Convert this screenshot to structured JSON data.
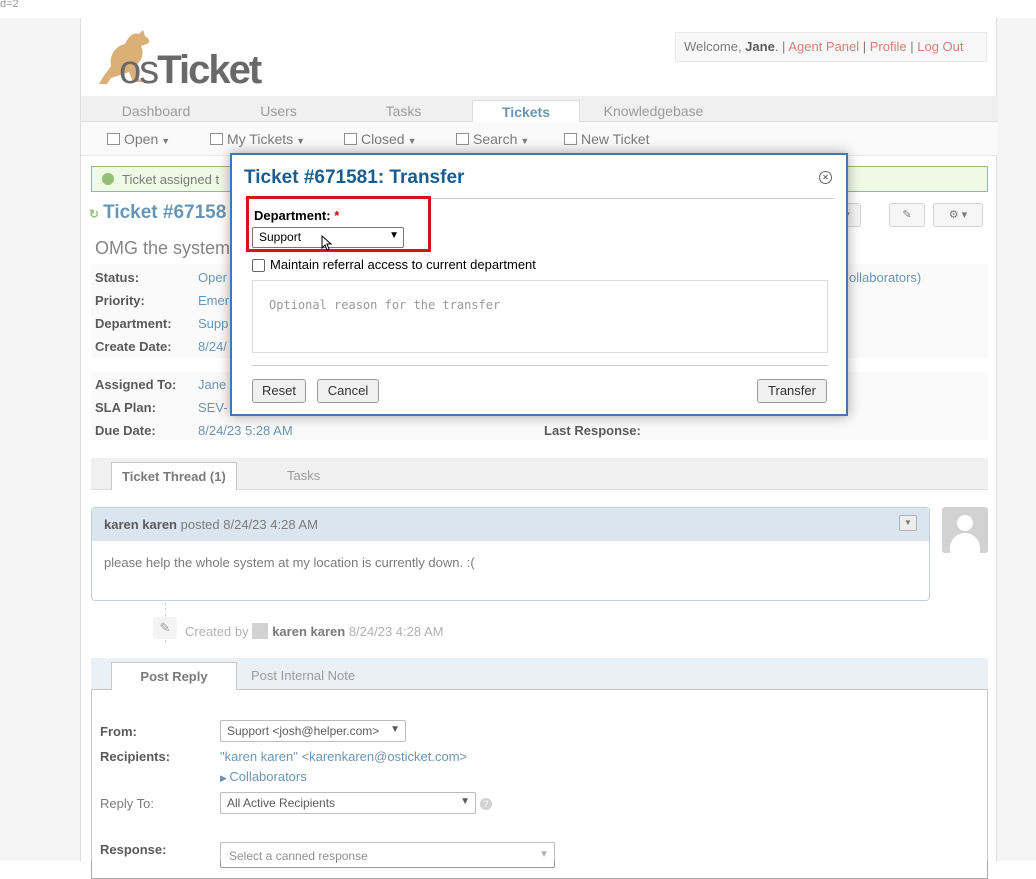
{
  "url_fragment": "d=2",
  "header": {
    "logo_text_os": "os",
    "logo_text_ticket": "Ticket",
    "welcome_prefix": "Welcome, ",
    "user": "Jane",
    "sep": ". | ",
    "agent_panel": "Agent Panel",
    "profile": "Profile",
    "logout": "Log Out"
  },
  "nav": {
    "tabs": [
      "Dashboard",
      "Users",
      "Tasks",
      "Tickets",
      "Knowledgebase"
    ],
    "active": "Tickets"
  },
  "subnav": {
    "open": "Open",
    "my_tickets": "My Tickets",
    "closed": "Closed",
    "search": "Search",
    "new_ticket": "New Ticket"
  },
  "notice": "Ticket assigned t",
  "ticket": {
    "number": "Ticket #67158",
    "subject": "OMG the system"
  },
  "info": {
    "status_k": "Status:",
    "status_v": "Oper",
    "priority_k": "Priority:",
    "priority_v": "Emer",
    "department_k": "Department:",
    "department_v": "Supp",
    "create_k": "Create Date:",
    "create_v": "8/24/",
    "collab_v": "ollaborators)",
    "assigned_k": "Assigned To:",
    "assigned_v": "Jane",
    "sla_k": "SLA Plan:",
    "sla_v": "SEV-",
    "due_k": "Due Date:",
    "due_v": "8/24/23 5:28 AM",
    "last_response_k": "Last Response:"
  },
  "thread_tabs": [
    "Ticket Thread (1)",
    "Tasks"
  ],
  "entry": {
    "poster": "karen karen",
    "posted": " posted 8/24/23 4:28 AM",
    "body": "please help the whole system at my location is currently down. :("
  },
  "event": {
    "created_by": "Created by ",
    "user": "karen karen",
    "time": " 8/24/23 4:28 AM"
  },
  "reply_tabs": [
    "Post Reply",
    "Post Internal Note"
  ],
  "reply": {
    "from_k": "From:",
    "from_v": "Support <josh@helper.com>",
    "recipients_k": "Recipients:",
    "recipients_v": "\"karen karen\" <karenkaren@osticket.com>",
    "collaborators": "Collaborators",
    "reply_to_k": "Reply To:",
    "reply_to_v": "All Active Recipients",
    "response_k": "Response:",
    "response_v": "Select a canned response"
  },
  "modal": {
    "title": "Ticket #671581: Transfer",
    "dept_label": "Department:",
    "required_mark": "*",
    "dept_value": "Support",
    "referral_label": "Maintain referral access to current department",
    "reason_placeholder": "Optional reason for the transfer",
    "reset": "Reset",
    "cancel": "Cancel",
    "transfer": "Transfer"
  },
  "colors": {
    "accent": "#1a5d8c",
    "link_red": "#c0392b",
    "highlight_red": "#d3141c",
    "success": "#5a9e2a"
  }
}
